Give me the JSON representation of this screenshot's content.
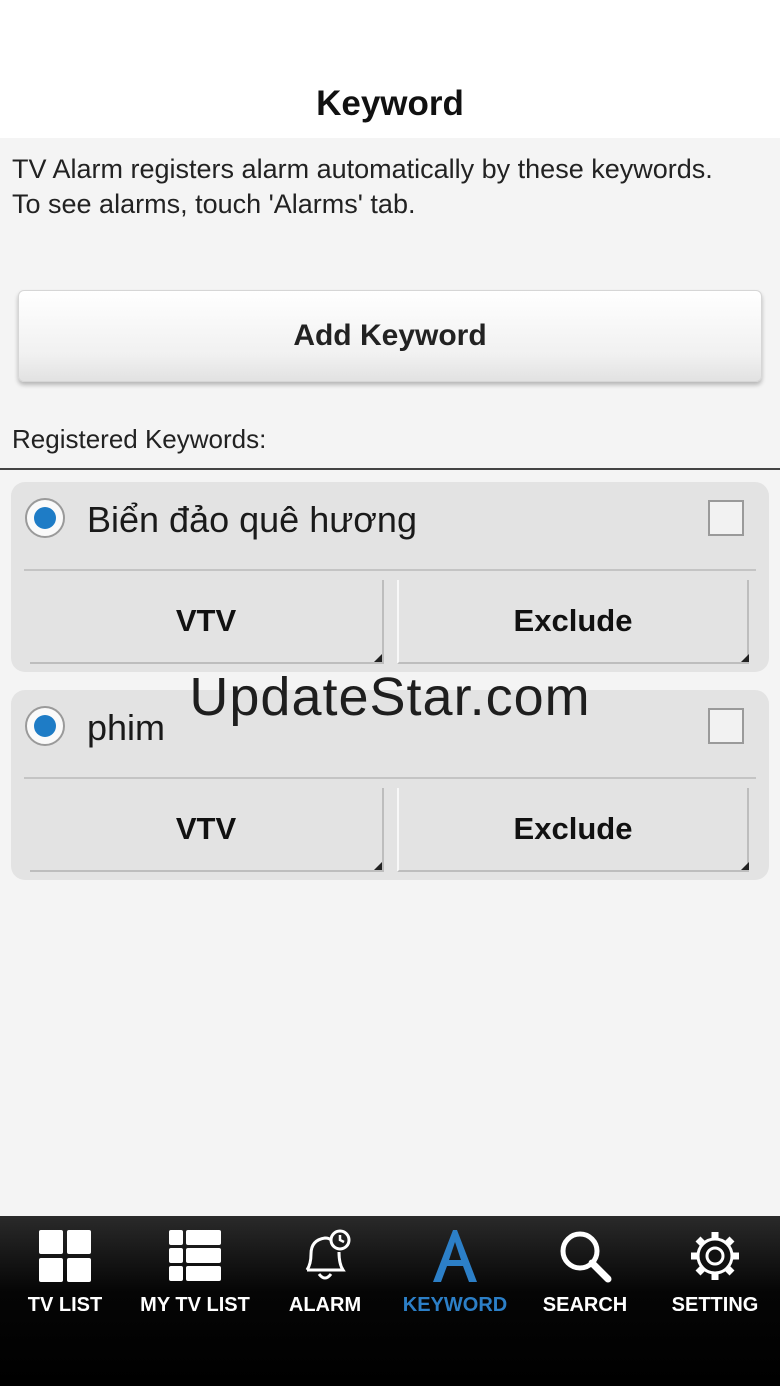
{
  "header": {
    "title": "Keyword"
  },
  "intro": {
    "line1": "TV Alarm registers alarm automatically by these keywords.",
    "line2": "To see alarms, touch 'Alarms' tab."
  },
  "add_button": {
    "label": "Add Keyword"
  },
  "registered_label": "Registered Keywords:",
  "keywords": [
    {
      "name": "Biển đảo quê hương",
      "channel": "VTV",
      "exclude": "Exclude",
      "radio_selected": true,
      "checked": false
    },
    {
      "name": "phim",
      "channel": "VTV",
      "exclude": "Exclude",
      "radio_selected": true,
      "checked": false
    }
  ],
  "watermark": "UpdateStar.com",
  "tabs": [
    {
      "label": "TV LIST",
      "icon": "grid-icon",
      "active": false
    },
    {
      "label": "MY TV LIST",
      "icon": "list-icon",
      "active": false
    },
    {
      "label": "ALARM",
      "icon": "bell-clock-icon",
      "active": false
    },
    {
      "label": "KEYWORD",
      "icon": "letter-a-icon",
      "active": true
    },
    {
      "label": "SEARCH",
      "icon": "search-icon",
      "active": false
    },
    {
      "label": "SETTING",
      "icon": "gear-icon",
      "active": false
    }
  ],
  "colors": {
    "accent": "#2c7fc7",
    "radio": "#1e7cc6",
    "tab_bar": "#000000"
  }
}
